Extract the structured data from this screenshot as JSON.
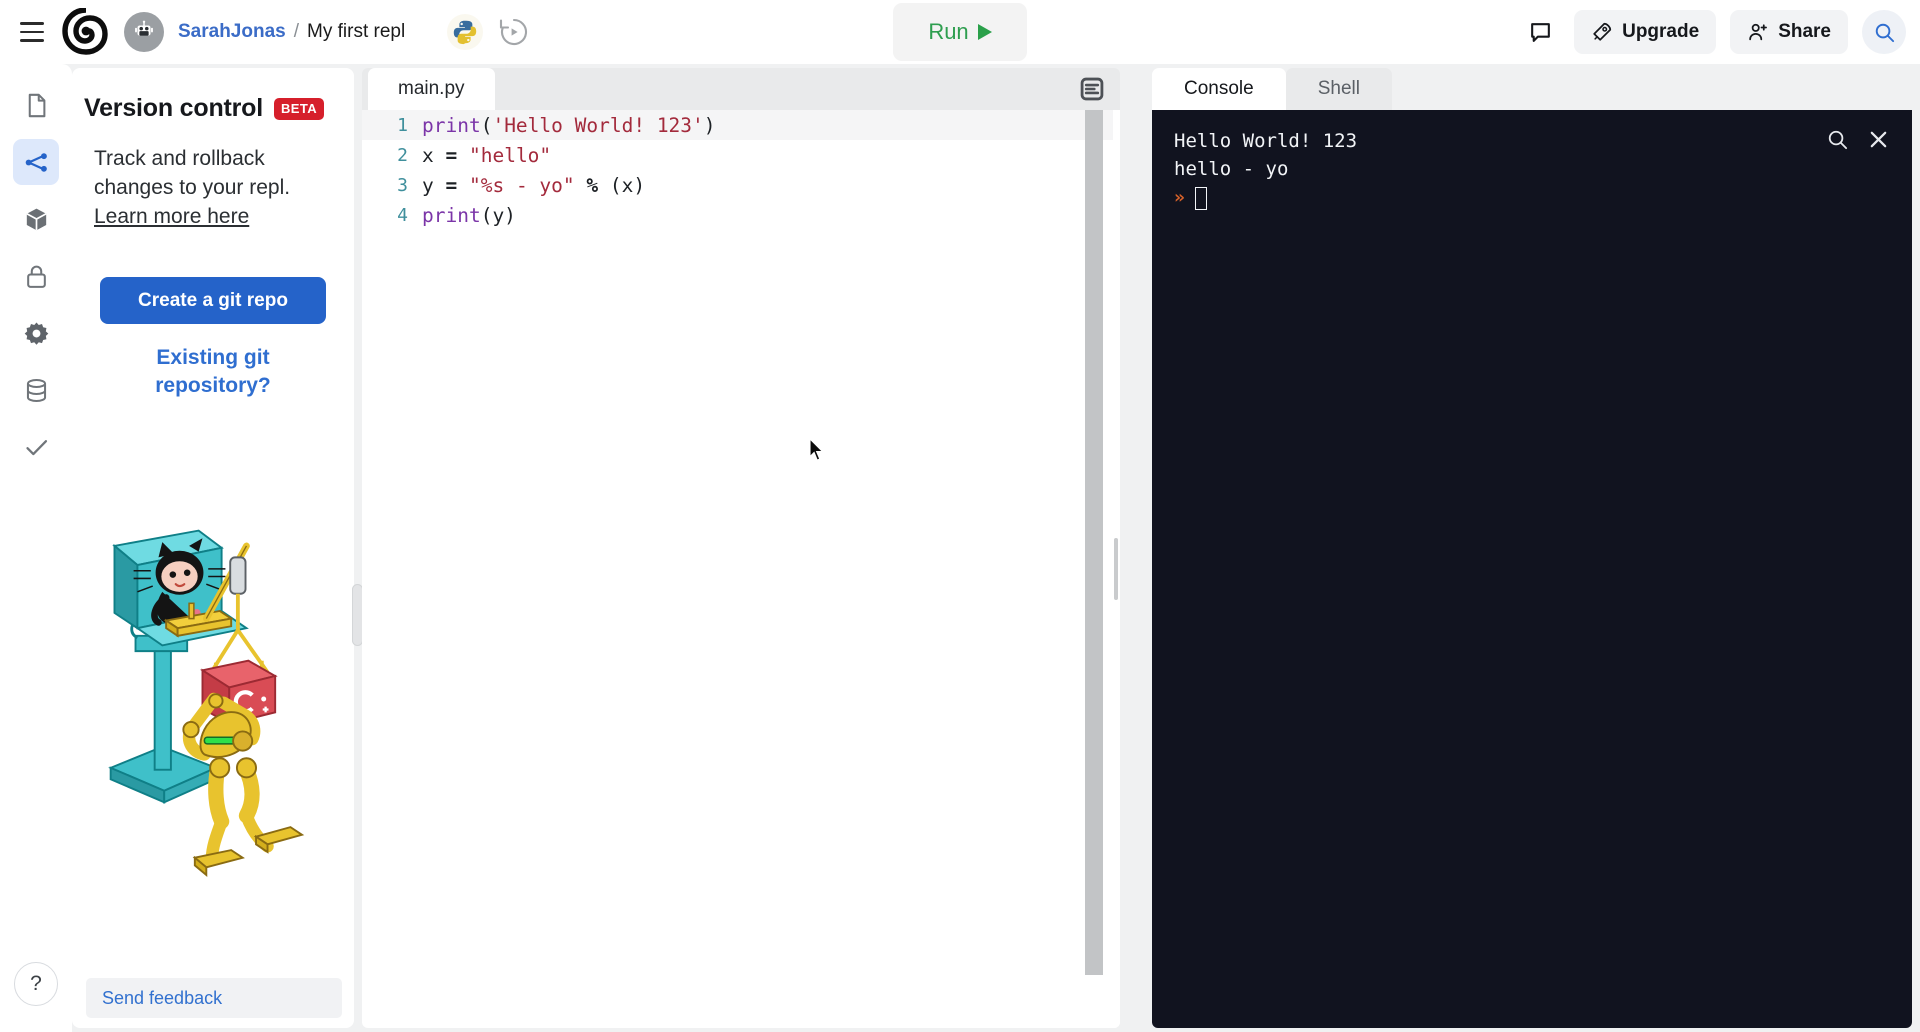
{
  "header": {
    "menu_icon": "hamburger-menu-icon",
    "logo_icon": "replit-logo-icon",
    "avatar_icon": "robot-avatar-icon",
    "breadcrumb": {
      "user": "SarahJonas",
      "separator": "/",
      "repl_name": "My first repl"
    },
    "language_badge": "python-logo-icon",
    "history_icon": "history-replay-icon",
    "run_label": "Run",
    "run_icon": "play-triangle-icon",
    "chat_icon": "comment-bubble-icon",
    "upgrade_label": "Upgrade",
    "upgrade_icon": "rocket-icon",
    "share_label": "Share",
    "share_icon": "person-plus-icon",
    "search_icon": "search-icon"
  },
  "rail": {
    "items": [
      {
        "name": "files",
        "icon": "file-icon",
        "active": false
      },
      {
        "name": "version-control",
        "icon": "git-branch-icon",
        "active": true
      },
      {
        "name": "packages",
        "icon": "cube-package-icon",
        "active": false
      },
      {
        "name": "secrets",
        "icon": "lock-icon",
        "active": false
      },
      {
        "name": "settings",
        "icon": "gear-icon",
        "active": false
      },
      {
        "name": "database",
        "icon": "database-icon",
        "active": false
      },
      {
        "name": "checks",
        "icon": "checkmark-icon",
        "active": false
      }
    ],
    "help_label": "?"
  },
  "sidebar": {
    "title": "Version control",
    "badge": "BETA",
    "description": "Track and rollback changes to your repl.",
    "learn_more": "Learn more here",
    "create_repo_label": "Create a git repo",
    "existing_repo_label": "Existing git repository?",
    "illustration": "octocat-crane-robot-illustration",
    "feedback_label": "Send feedback"
  },
  "editor": {
    "tab_label": "main.py",
    "format_icon": "format-code-icon",
    "lines": [
      {
        "number": "1",
        "text": "print('Hello World! 123')",
        "highlighted": true
      },
      {
        "number": "2",
        "text": "x = \"hello\"",
        "highlighted": false
      },
      {
        "number": "3",
        "text": "y = \"%s - yo\" % (x)",
        "highlighted": false
      },
      {
        "number": "4",
        "text": "print(y)",
        "highlighted": false
      }
    ]
  },
  "console": {
    "tabs": [
      {
        "label": "Console",
        "active": true
      },
      {
        "label": "Shell",
        "active": false
      }
    ],
    "search_icon": "search-icon",
    "close_icon": "close-icon",
    "output": [
      "Hello World! 123",
      "hello - yo"
    ],
    "prompt_symbol": "»"
  },
  "colors": {
    "accent_blue": "#2563c9",
    "link_blue": "#3271cf",
    "beta_red": "#d61f2b",
    "run_green": "#2e9e4f",
    "console_bg": "#11131f",
    "prompt_orange": "#d8622a"
  }
}
